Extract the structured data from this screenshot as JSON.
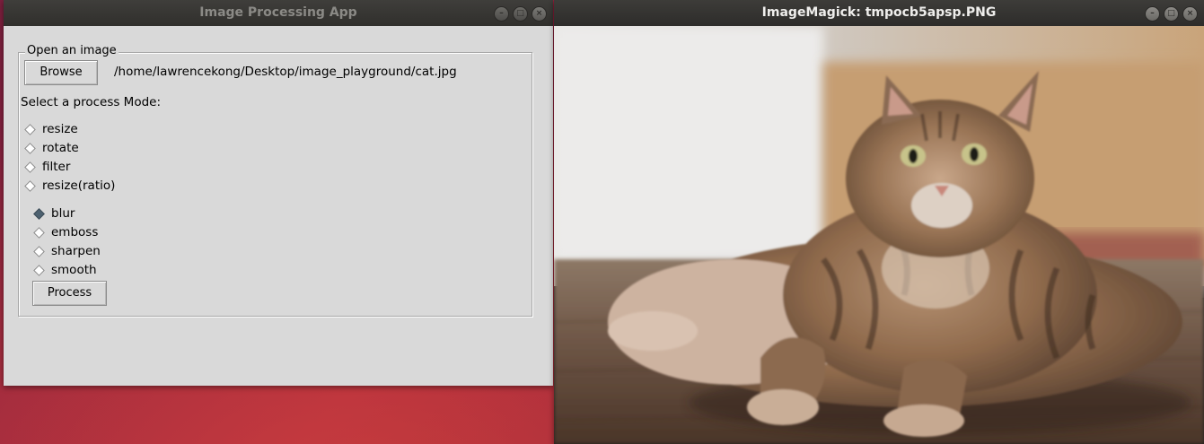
{
  "app_window": {
    "title": "Image Processing App",
    "group_label": "Open an image",
    "browse_button": "Browse",
    "file_path": "/home/lawrencekong/Desktop/image_playground/cat.jpg",
    "mode_prompt": "Select a process Mode:",
    "modes": [
      {
        "label": "resize",
        "selected": false
      },
      {
        "label": "rotate",
        "selected": false
      },
      {
        "label": "filter",
        "selected": false
      },
      {
        "label": "resize(ratio)",
        "selected": false
      }
    ],
    "filters": [
      {
        "label": "blur",
        "selected": true
      },
      {
        "label": "emboss",
        "selected": false
      },
      {
        "label": "sharpen",
        "selected": false
      },
      {
        "label": "smooth",
        "selected": false
      }
    ],
    "process_button": "Process"
  },
  "viewer_window": {
    "title": "ImageMagick: tmpocb5apsp.PNG",
    "image_subject": "blurred photo of a tabby cat lying on a wooden floor"
  },
  "window_controls": {
    "minimize_icon": "minimize-icon",
    "maximize_icon": "maximize-icon",
    "close_icon": "close-icon"
  },
  "colors": {
    "window_bg": "#d9d9d9",
    "titlebar": "#302f2c",
    "desktop": "#a3243f",
    "radio_selected": "#4d6170"
  }
}
